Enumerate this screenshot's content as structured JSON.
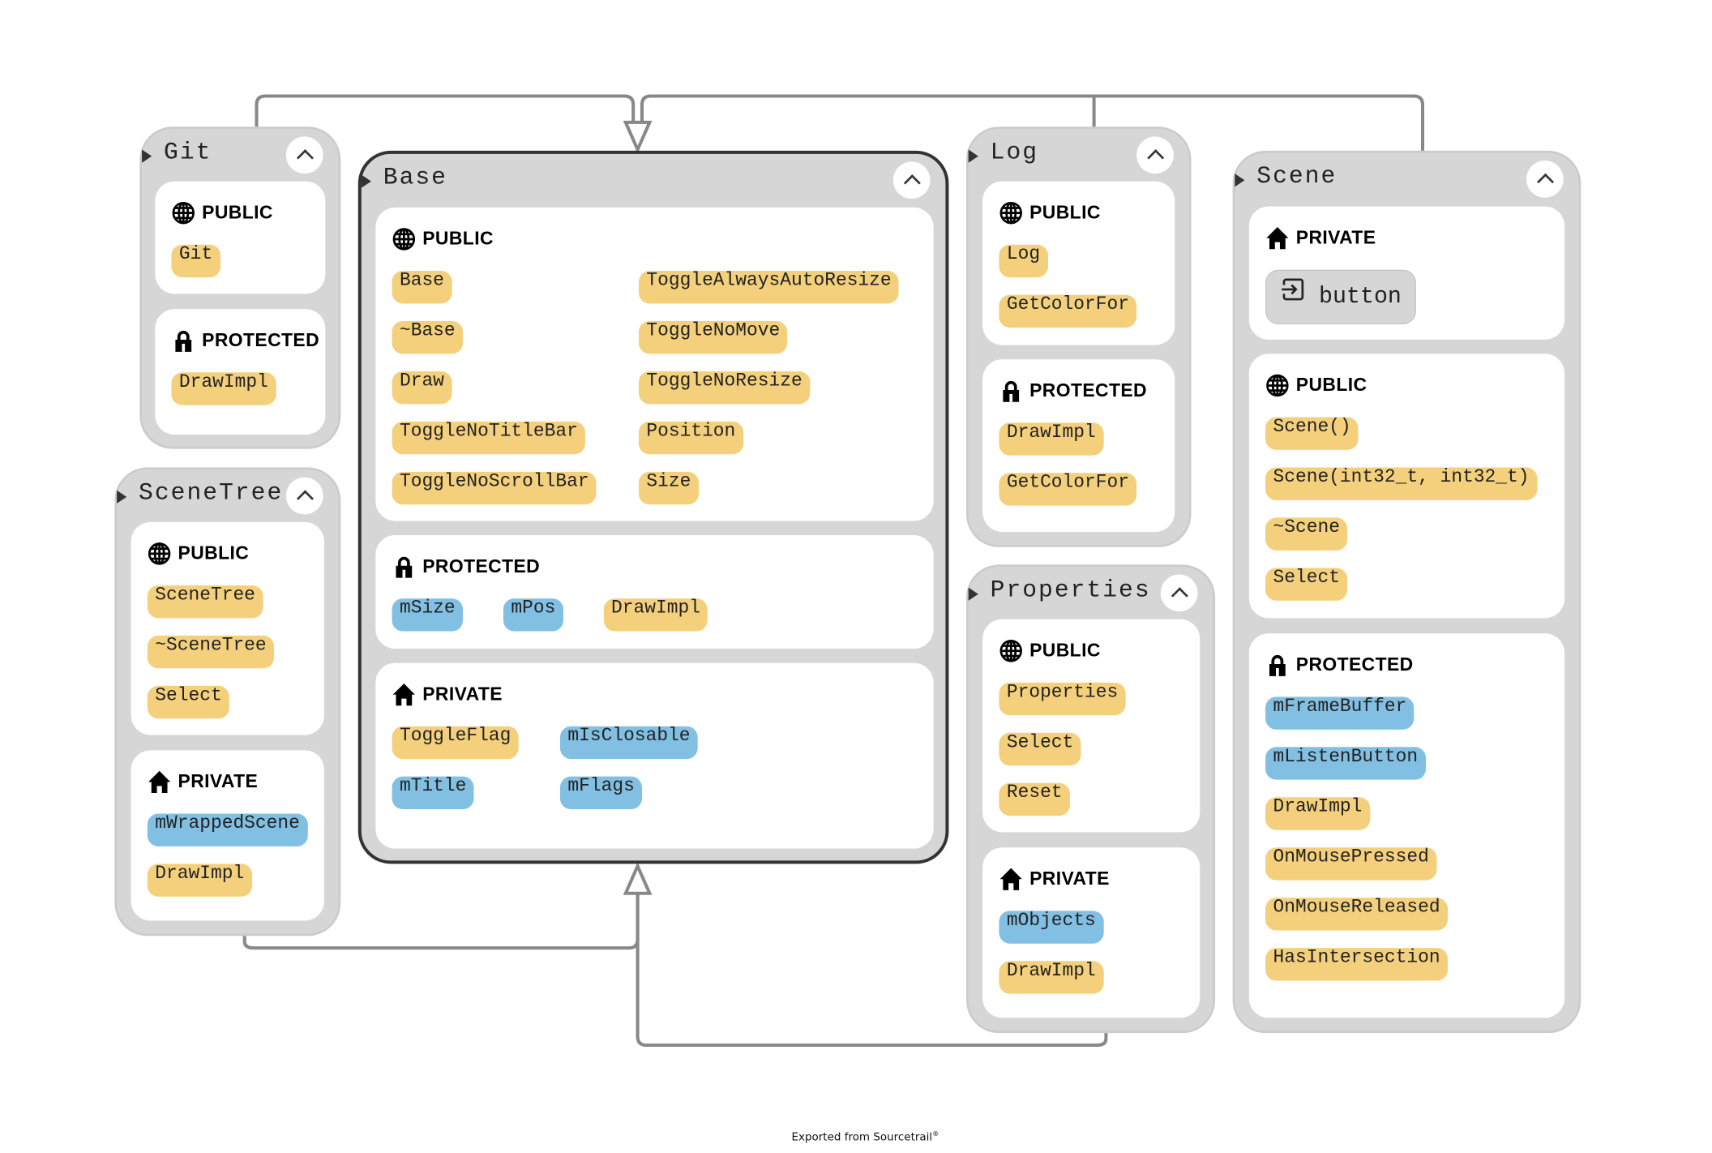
{
  "colors": {
    "function": "#f4d07d",
    "variable": "#82c0e3",
    "node": "#d6d6d6",
    "edge": "#888888",
    "active_border": "#333333"
  },
  "nodes": [
    {
      "title": "Git",
      "sections": [
        {
          "kind": "public",
          "icon": "globe-icon",
          "label": "PUBLIC",
          "items": [
            {
              "name": "Git",
              "type": "function"
            }
          ]
        },
        {
          "kind": "protected",
          "icon": "lock-icon",
          "label": "PROTECTED",
          "items": [
            {
              "name": "DrawImpl",
              "type": "function"
            }
          ]
        }
      ]
    },
    {
      "title": "SceneTree",
      "sections": [
        {
          "kind": "public",
          "icon": "globe-icon",
          "label": "PUBLIC",
          "items": [
            {
              "name": "SceneTree",
              "type": "function"
            },
            {
              "name": "~SceneTree",
              "type": "function"
            },
            {
              "name": "Select",
              "type": "function"
            }
          ]
        },
        {
          "kind": "private",
          "icon": "home-icon",
          "label": "PRIVATE",
          "items": [
            {
              "name": "mWrappedScene",
              "type": "variable"
            },
            {
              "name": "DrawImpl",
              "type": "function"
            }
          ]
        }
      ]
    },
    {
      "title": "Base",
      "active": true,
      "sections": [
        {
          "kind": "public",
          "icon": "globe-icon",
          "label": "PUBLIC",
          "items": [
            {
              "name": "Base",
              "type": "function"
            },
            {
              "name": "ToggleAlwaysAutoResize",
              "type": "function"
            },
            {
              "name": "~Base",
              "type": "function"
            },
            {
              "name": "ToggleNoMove",
              "type": "function"
            },
            {
              "name": "Draw",
              "type": "function"
            },
            {
              "name": "ToggleNoResize",
              "type": "function"
            },
            {
              "name": "ToggleNoTitleBar",
              "type": "function"
            },
            {
              "name": "Position",
              "type": "function"
            },
            {
              "name": "ToggleNoScrollBar",
              "type": "function"
            },
            {
              "name": "Size",
              "type": "function"
            }
          ]
        },
        {
          "kind": "protected",
          "icon": "lock-icon",
          "label": "PROTECTED",
          "items": [
            {
              "name": "mSize",
              "type": "variable"
            },
            {
              "name": "mPos",
              "type": "variable"
            },
            {
              "name": "DrawImpl",
              "type": "function"
            }
          ]
        },
        {
          "kind": "private",
          "icon": "home-icon",
          "label": "PRIVATE",
          "items": [
            {
              "name": "ToggleFlag",
              "type": "function"
            },
            {
              "name": "mIsClosable",
              "type": "variable"
            },
            {
              "name": "mTitle",
              "type": "variable"
            },
            {
              "name": "mFlags",
              "type": "variable"
            }
          ]
        }
      ]
    },
    {
      "title": "Log",
      "sections": [
        {
          "kind": "public",
          "icon": "globe-icon",
          "label": "PUBLIC",
          "items": [
            {
              "name": "Log",
              "type": "function"
            },
            {
              "name": "GetColorFor",
              "type": "function"
            }
          ]
        },
        {
          "kind": "protected",
          "icon": "lock-icon",
          "label": "PROTECTED",
          "items": [
            {
              "name": "DrawImpl",
              "type": "function"
            },
            {
              "name": "GetColorFor",
              "type": "function"
            }
          ]
        }
      ]
    },
    {
      "title": "Properties",
      "sections": [
        {
          "kind": "public",
          "icon": "globe-icon",
          "label": "PUBLIC",
          "items": [
            {
              "name": "Properties",
              "type": "function"
            },
            {
              "name": "Select",
              "type": "function"
            },
            {
              "name": "Reset",
              "type": "function"
            }
          ]
        },
        {
          "kind": "private",
          "icon": "home-icon",
          "label": "PRIVATE",
          "items": [
            {
              "name": "mObjects",
              "type": "variable"
            },
            {
              "name": "DrawImpl",
              "type": "function"
            }
          ]
        }
      ]
    },
    {
      "title": "Scene",
      "sections": [
        {
          "kind": "private",
          "icon": "home-icon",
          "label": "PRIVATE",
          "items": [
            {
              "name": "button",
              "type": "special",
              "icon": "box-arrow-in-icon"
            }
          ]
        },
        {
          "kind": "public",
          "icon": "globe-icon",
          "label": "PUBLIC",
          "items": [
            {
              "name": "Scene()",
              "type": "function"
            },
            {
              "name": "Scene(int32_t, int32_t)",
              "type": "function"
            },
            {
              "name": "~Scene",
              "type": "function"
            },
            {
              "name": "Select",
              "type": "function"
            }
          ]
        },
        {
          "kind": "protected",
          "icon": "lock-icon",
          "label": "PROTECTED",
          "items": [
            {
              "name": "mFrameBuffer",
              "type": "variable"
            },
            {
              "name": "mListenButton",
              "type": "variable"
            },
            {
              "name": "DrawImpl",
              "type": "function"
            },
            {
              "name": "OnMousePressed",
              "type": "function"
            },
            {
              "name": "OnMouseReleased",
              "type": "function"
            },
            {
              "name": "HasIntersection",
              "type": "function"
            }
          ]
        }
      ]
    }
  ],
  "footer": {
    "text": "Exported from Sourcetrail",
    "mark": "®"
  }
}
